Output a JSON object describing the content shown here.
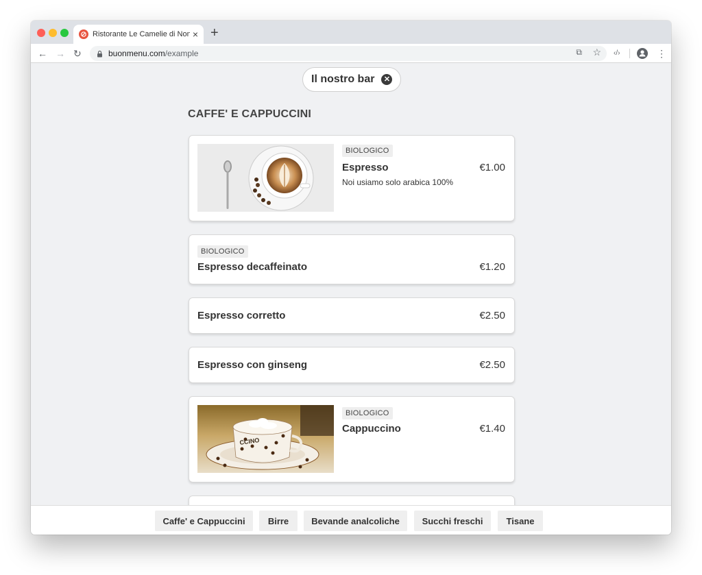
{
  "browser": {
    "tab_title": "Ristorante Le Camelie di Nonna Ida",
    "url_host": "buonmenu.com",
    "url_path": "/example"
  },
  "filter": {
    "label": "Il nostro bar"
  },
  "section": {
    "title": "CAFFE' E CAPPUCCINI"
  },
  "items": [
    {
      "badge": "BIOLOGICO",
      "name": "Espresso",
      "price": "€1.00",
      "description": "Noi usiamo solo arabica 100%"
    },
    {
      "badge": "BIOLOGICO",
      "name": "Espresso decaffeinato",
      "price": "€1.20"
    },
    {
      "name": "Espresso corretto",
      "price": "€2.50"
    },
    {
      "name": "Espresso con ginseng",
      "price": "€2.50"
    },
    {
      "badge": "BIOLOGICO",
      "name": "Cappuccino",
      "price": "€1.40",
      "cup_text": "CCINO"
    }
  ],
  "categories": [
    "Caffe' e Cappuccini",
    "Birre",
    "Bevande analcoliche",
    "Succhi freschi",
    "Tisane"
  ],
  "colors": {
    "favicon": "#e8543f",
    "page_bg": "#f0f1f3",
    "card_bg": "#ffffff"
  }
}
